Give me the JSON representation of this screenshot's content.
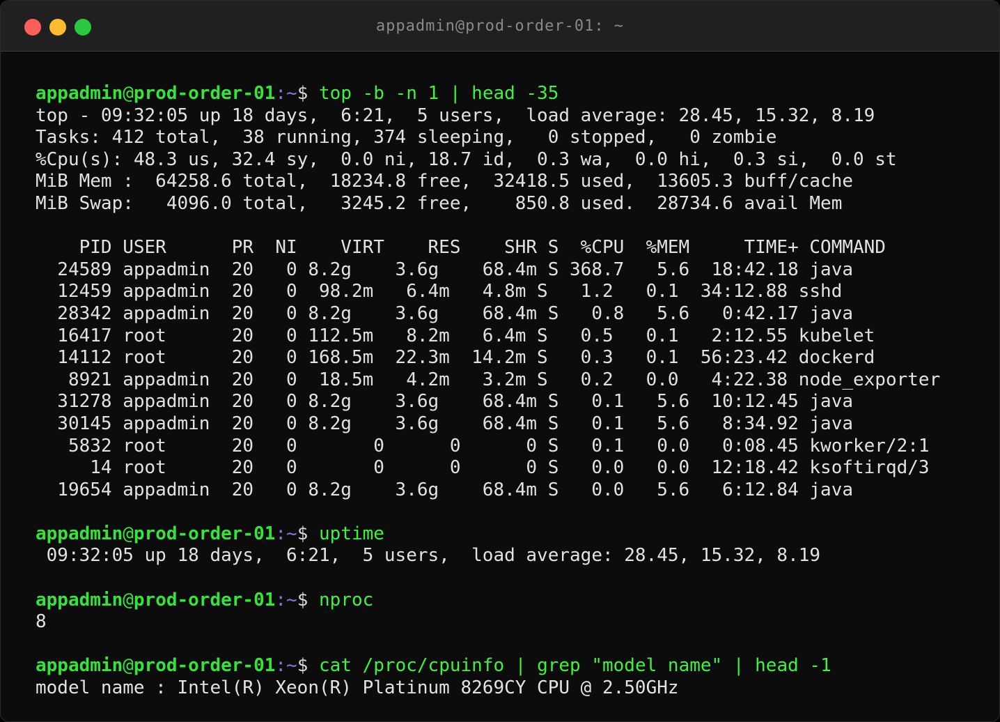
{
  "window": {
    "title": "appadmin@prod-order-01: ~"
  },
  "prompt": {
    "user": "appadmin",
    "at": "@",
    "host": "prod-order-01",
    "path": ":~",
    "dollar": "$ "
  },
  "blocks": [
    {
      "command": "top -b -n 1 | head -35",
      "output": [
        "top - 09:32:05 up 18 days,  6:21,  5 users,  load average: 28.45, 15.32, 8.19",
        "Tasks: 412 total,  38 running, 374 sleeping,   0 stopped,   0 zombie",
        "%Cpu(s): 48.3 us, 32.4 sy,  0.0 ni, 18.7 id,  0.3 wa,  0.0 hi,  0.3 si,  0.0 st",
        "MiB Mem :  64258.6 total,  18234.8 free,  32418.5 used,  13605.3 buff/cache",
        "MiB Swap:   4096.0 total,   3245.2 free,    850.8 used.  28734.6 avail Mem",
        "",
        "    PID USER      PR  NI    VIRT    RES    SHR S  %CPU  %MEM     TIME+ COMMAND",
        "  24589 appadmin  20   0 8.2g    3.6g    68.4m S 368.7   5.6  18:42.18 java",
        "  12459 appadmin  20   0  98.2m   6.4m   4.8m S   1.2   0.1  34:12.88 sshd",
        "  28342 appadmin  20   0 8.2g    3.6g    68.4m S   0.8   5.6   0:42.17 java",
        "  16417 root      20   0 112.5m   8.2m   6.4m S   0.5   0.1   2:12.55 kubelet",
        "  14112 root      20   0 168.5m  22.3m  14.2m S   0.3   0.1  56:23.42 dockerd",
        "   8921 appadmin  20   0  18.5m   4.2m   3.2m S   0.2   0.0   4:22.38 node_exporter",
        "  31278 appadmin  20   0 8.2g    3.6g    68.4m S   0.1   5.6  10:12.45 java",
        "  30145 appadmin  20   0 8.2g    3.6g    68.4m S   0.1   5.6   8:34.92 java",
        "   5832 root      20   0       0      0      0 S   0.1   0.0   0:08.45 kworker/2:1",
        "     14 root      20   0       0      0      0 S   0.0   0.0  12:18.42 ksoftirqd/3",
        "  19654 appadmin  20   0 8.2g    3.6g    68.4m S   0.0   5.6   6:12.84 java"
      ]
    },
    {
      "command": "uptime",
      "output": [
        " 09:32:05 up 18 days,  6:21,  5 users,  load average: 28.45, 15.32, 8.19"
      ]
    },
    {
      "command": "nproc",
      "output": [
        "8"
      ]
    },
    {
      "command": "cat /proc/cpuinfo | grep \"model name\" | head -1",
      "output": [
        "model name : Intel(R) Xeon(R) Platinum 8269CY CPU @ 2.50GHz"
      ]
    }
  ]
}
